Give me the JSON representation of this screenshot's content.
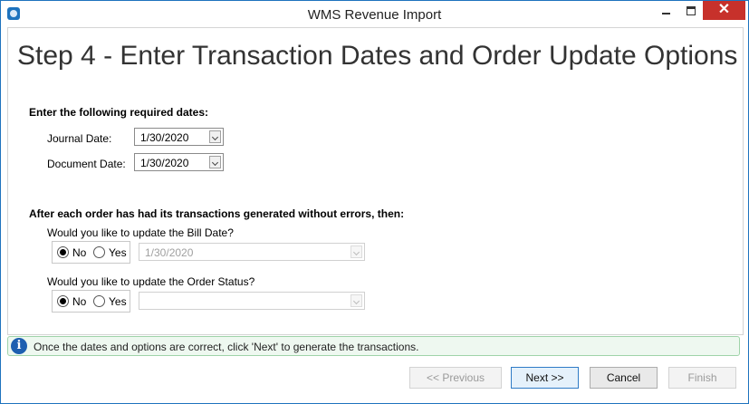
{
  "window": {
    "title": "WMS Revenue Import",
    "close_glyph": "✕"
  },
  "step_title": "Step 4 - Enter Transaction Dates and Order Update Options",
  "dates": {
    "section_label": "Enter the following required dates:",
    "journal_label": "Journal Date:",
    "journal_value": "1/30/2020",
    "document_label": "Document Date:",
    "document_value": "1/30/2020"
  },
  "options": {
    "section_label": "After each order has had its transactions generated without errors, then:",
    "bill_date_question": "Would you like to update the Bill Date?",
    "bill_date_value": "1/30/2020",
    "order_status_question": "Would you like to update the Order Status?",
    "order_status_value": "",
    "no_label": "No",
    "yes_label": "Yes",
    "bill_date_selected": "No",
    "order_status_selected": "No"
  },
  "info": {
    "icon_glyph": "i",
    "message": "Once the dates and options are correct, click 'Next' to generate the transactions."
  },
  "buttons": {
    "previous": "<< Previous",
    "next": "Next >>",
    "cancel": "Cancel",
    "finish": "Finish"
  },
  "colors": {
    "accent": "#1e73be",
    "close_button": "#c7312b",
    "info_bg": "#eef8f0",
    "info_border": "#9fd3a9"
  }
}
